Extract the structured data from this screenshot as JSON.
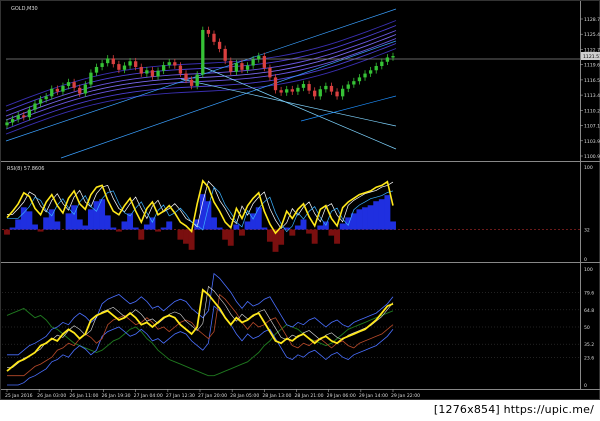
{
  "chart_data": {
    "type": "line",
    "symbol_label": "GOLD,M30",
    "x_ticks": [
      "25 Jan 2016",
      "26 Jan 03:00",
      "26 Jan 11:00",
      "26 Jan 19:30",
      "27 Jan 04:00",
      "27 Jan 12:30",
      "27 Jan 20:00",
      "28 Jan 05:00",
      "28 Jan 13:00",
      "28 Jan 21:00",
      "29 Jan 06:00",
      "29 Jan 14:00",
      "29 Jan 22:00"
    ],
    "price_panel": {
      "type": "candlestick",
      "ylim": [
        1100,
        1131
      ],
      "y_ticks": [
        "1128.70",
        "1125.45",
        "1122.75",
        "1119.65",
        "1116.55",
        "1113.40",
        "1110.25",
        "1107.10",
        "1103.95",
        "1100.90"
      ],
      "current_price": "1121.51",
      "close": [
        1107.5,
        1108.2,
        1109.0,
        1108.6,
        1110.2,
        1111.5,
        1112.4,
        1113.0,
        1114.6,
        1114.0,
        1115.2,
        1116.0,
        1114.8,
        1113.6,
        1115.5,
        1118.0,
        1119.2,
        1120.0,
        1121.0,
        1119.8,
        1118.6,
        1119.5,
        1120.4,
        1119.2,
        1117.8,
        1118.5,
        1117.2,
        1118.4,
        1119.6,
        1120.2,
        1119.5,
        1117.8,
        1116.5,
        1115.2,
        1117.6,
        1127.0,
        1126.2,
        1124.5,
        1123.0,
        1120.5,
        1118.2,
        1120.0,
        1118.6,
        1119.5,
        1120.8,
        1121.5,
        1119.0,
        1117.0,
        1114.3,
        1113.8,
        1114.5,
        1114.0,
        1114.8,
        1115.6,
        1114.2,
        1113.0,
        1114.5,
        1115.2,
        1114.0,
        1113.0,
        1114.6,
        1115.5,
        1116.2,
        1117.0,
        1117.8,
        1118.5,
        1119.4,
        1120.3,
        1121.2,
        1121.5
      ]
    },
    "rsi_panel": {
      "label": "RSI(8) 57.8606",
      "ylim": [
        0,
        100
      ],
      "y_ticks": [
        "100",
        "32",
        "0"
      ],
      "level": 32,
      "values": [
        45,
        52,
        60,
        72,
        68,
        55,
        48,
        62,
        70,
        58,
        50,
        66,
        74,
        60,
        54,
        70,
        78,
        80,
        64,
        52,
        48,
        58,
        66,
        52,
        40,
        55,
        62,
        48,
        52,
        58,
        50,
        40,
        36,
        30,
        60,
        85,
        78,
        62,
        52,
        40,
        34,
        55,
        44,
        58,
        66,
        72,
        52,
        38,
        28,
        35,
        52,
        44,
        54,
        60,
        46,
        36,
        54,
        58,
        44,
        36,
        56,
        62,
        66,
        70,
        72,
        74,
        78,
        80,
        84,
        58
      ]
    },
    "osc_panel": {
      "ylim": [
        0,
        100
      ],
      "y_ticks": [
        "100",
        "79.6",
        "64.8",
        "50",
        "35.2",
        "23.6",
        "0"
      ],
      "main_values": [
        12,
        16,
        20,
        22,
        25,
        28,
        34,
        36,
        40,
        38,
        44,
        48,
        45,
        40,
        44,
        56,
        60,
        62,
        64,
        60,
        56,
        58,
        62,
        58,
        52,
        54,
        50,
        54,
        58,
        60,
        58,
        52,
        48,
        44,
        50,
        82,
        78,
        72,
        66,
        58,
        52,
        58,
        54,
        56,
        60,
        62,
        54,
        46,
        38,
        36,
        40,
        38,
        42,
        44,
        40,
        36,
        40,
        42,
        38,
        36,
        40,
        42,
        44,
        46,
        48,
        52,
        56,
        62,
        68,
        70
      ],
      "green_values": [
        60,
        62,
        64,
        66,
        62,
        58,
        60,
        56,
        50,
        48,
        44,
        40,
        36,
        34,
        32,
        30,
        28,
        30,
        34,
        38,
        40,
        44,
        48,
        50,
        46,
        40,
        36,
        30,
        26,
        22,
        20,
        18,
        16,
        14,
        12,
        10,
        8,
        8,
        10,
        12,
        14,
        16,
        18,
        20,
        24,
        28,
        34,
        38,
        44,
        48,
        52,
        50,
        48,
        44,
        40,
        38,
        36,
        34,
        36,
        40,
        44,
        48,
        50,
        52,
        54,
        56,
        58,
        60,
        62,
        64
      ]
    }
  },
  "watermark": "[1276x854] https://upic.me/"
}
